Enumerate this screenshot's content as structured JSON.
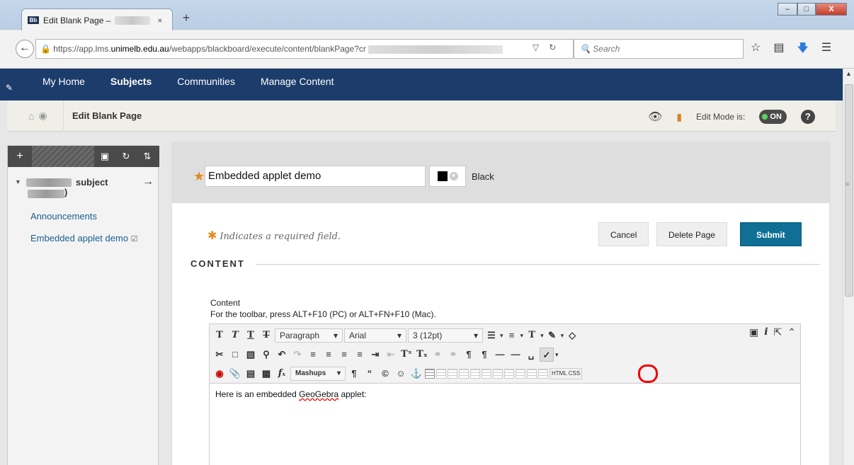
{
  "browser": {
    "tab_title": "Edit Blank Page –",
    "tab_close": "×",
    "new_tab": "+",
    "url_prefix": "https://app.lms.",
    "url_domain": "unimelb.edu.au",
    "url_path": "/webapps/blackboard/execute/content/blankPage?cr",
    "search_placeholder": "Search",
    "window_controls": {
      "minimize": "–",
      "maximize": "□",
      "close": "X"
    }
  },
  "topnav": {
    "items": [
      {
        "label": "My Home"
      },
      {
        "label": "Subjects",
        "active": true
      },
      {
        "label": "Communities"
      },
      {
        "label": "Manage Content"
      }
    ]
  },
  "breadcrumb": {
    "title": "Edit Blank Page",
    "edit_mode_label": "Edit Mode is:",
    "edit_mode_value": "ON",
    "help": "?"
  },
  "leftmenu": {
    "course_suffix": "subject",
    "course_paren": ")",
    "links": [
      {
        "label": "Announcements"
      },
      {
        "label": "Embedded applet demo"
      }
    ]
  },
  "form": {
    "title_value": "Embedded applet demo",
    "color_label": "Black",
    "required_note": "Indicates a required field.",
    "cancel": "Cancel",
    "delete": "Delete Page",
    "submit": "Submit",
    "section_header": "CONTENT",
    "content_label": "Content",
    "toolbar_help": "For the toolbar, press ALT+F10 (PC) or ALT+FN+F10 (Mac)."
  },
  "editor": {
    "paragraph": "Paragraph",
    "font": "Arial",
    "size": "3 (12pt)",
    "mashups": "Mashups",
    "htmlcss": "HTML CSS",
    "body_text_before": "Here is an embedded ",
    "body_text_word": "GeoGebra",
    "body_text_after": " applet:"
  },
  "colors": {
    "nav_blue": "#1c3c6b",
    "submit_teal": "#0f6f95",
    "required_orange": "#e58a1f",
    "link_blue": "#1a5f8f"
  }
}
